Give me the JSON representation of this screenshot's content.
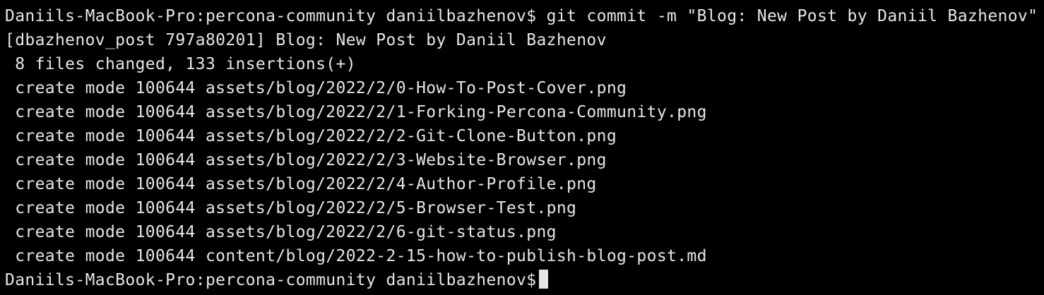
{
  "terminal": {
    "lines": [
      "Daniils-MacBook-Pro:percona-community daniilbazhenov$ git commit -m \"Blog: New Post by Daniil Bazhenov\"",
      "[dbazhenov_post 797a80201] Blog: New Post by Daniil Bazhenov",
      " 8 files changed, 133 insertions(+)",
      " create mode 100644 assets/blog/2022/2/0-How-To-Post-Cover.png",
      " create mode 100644 assets/blog/2022/2/1-Forking-Percona-Community.png",
      " create mode 100644 assets/blog/2022/2/2-Git-Clone-Button.png",
      " create mode 100644 assets/blog/2022/2/3-Website-Browser.png",
      " create mode 100644 assets/blog/2022/2/4-Author-Profile.png",
      " create mode 100644 assets/blog/2022/2/5-Browser-Test.png",
      " create mode 100644 assets/blog/2022/2/6-git-status.png",
      " create mode 100644 content/blog/2022-2-15-how-to-publish-blog-post.md"
    ],
    "prompt": "Daniils-MacBook-Pro:percona-community daniilbazhenov$",
    "colors": {
      "background": "#000000",
      "foreground": "#e6e6e6",
      "cursor": "#e6e6e6"
    }
  }
}
